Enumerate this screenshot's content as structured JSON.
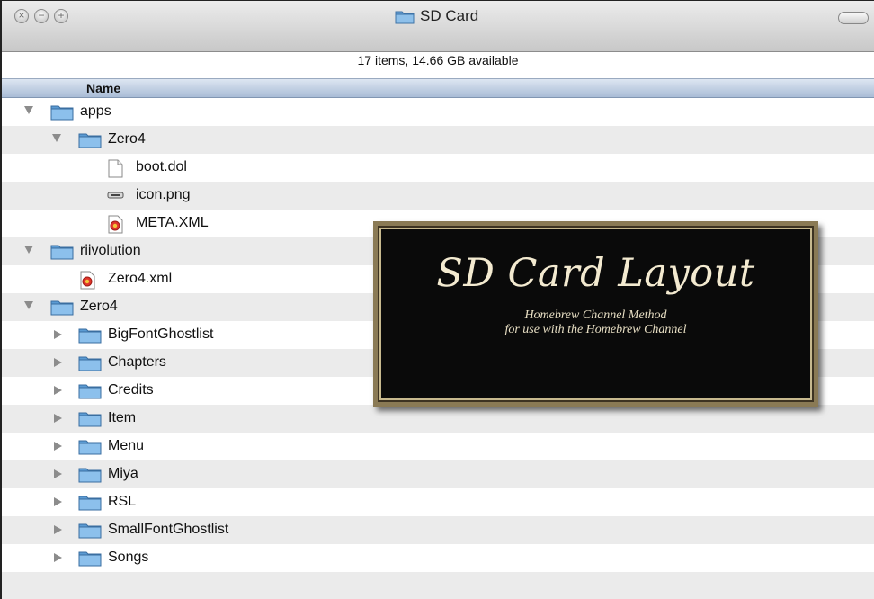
{
  "window": {
    "title": "SD Card",
    "status": "17 items, 14.66 GB available",
    "column_header": "Name",
    "buttons": [
      "close",
      "minimize",
      "zoom"
    ]
  },
  "rows": [
    {
      "label": "apps",
      "icon": "folder-icon",
      "level": 0,
      "disclosure": "open"
    },
    {
      "label": "Zero4",
      "icon": "folder-icon",
      "level": 1,
      "disclosure": "open"
    },
    {
      "label": "boot.dol",
      "icon": "document-icon",
      "level": 2,
      "disclosure": "none"
    },
    {
      "label": "icon.png",
      "icon": "image-icon",
      "level": 2,
      "disclosure": "none"
    },
    {
      "label": "META.XML",
      "icon": "xml-icon",
      "level": 2,
      "disclosure": "none"
    },
    {
      "label": "riivolution",
      "icon": "folder-icon",
      "level": 0,
      "disclosure": "open"
    },
    {
      "label": "Zero4.xml",
      "icon": "xml-icon",
      "level": 1,
      "disclosure": "none"
    },
    {
      "label": "Zero4",
      "icon": "folder-icon",
      "level": 0,
      "disclosure": "open"
    },
    {
      "label": "BigFontGhostlist",
      "icon": "folder-icon",
      "level": 1,
      "disclosure": "closed"
    },
    {
      "label": "Chapters",
      "icon": "folder-icon",
      "level": 1,
      "disclosure": "closed"
    },
    {
      "label": "Credits",
      "icon": "folder-icon",
      "level": 1,
      "disclosure": "closed"
    },
    {
      "label": "Item",
      "icon": "folder-icon",
      "level": 1,
      "disclosure": "closed"
    },
    {
      "label": "Menu",
      "icon": "folder-icon",
      "level": 1,
      "disclosure": "closed"
    },
    {
      "label": "Miya",
      "icon": "folder-icon",
      "level": 1,
      "disclosure": "closed"
    },
    {
      "label": "RSL",
      "icon": "folder-icon",
      "level": 1,
      "disclosure": "closed"
    },
    {
      "label": "SmallFontGhostlist",
      "icon": "folder-icon",
      "level": 1,
      "disclosure": "closed"
    },
    {
      "label": "Songs",
      "icon": "folder-icon",
      "level": 1,
      "disclosure": "closed"
    }
  ],
  "banner": {
    "title": "SD Card Layout",
    "line1": "Homebrew Channel Method",
    "line2": "for use with the Homebrew Channel"
  },
  "colors": {
    "folder": "#5b9bd3",
    "header": "#a9bcd6",
    "stripe": "#ebebeb"
  }
}
